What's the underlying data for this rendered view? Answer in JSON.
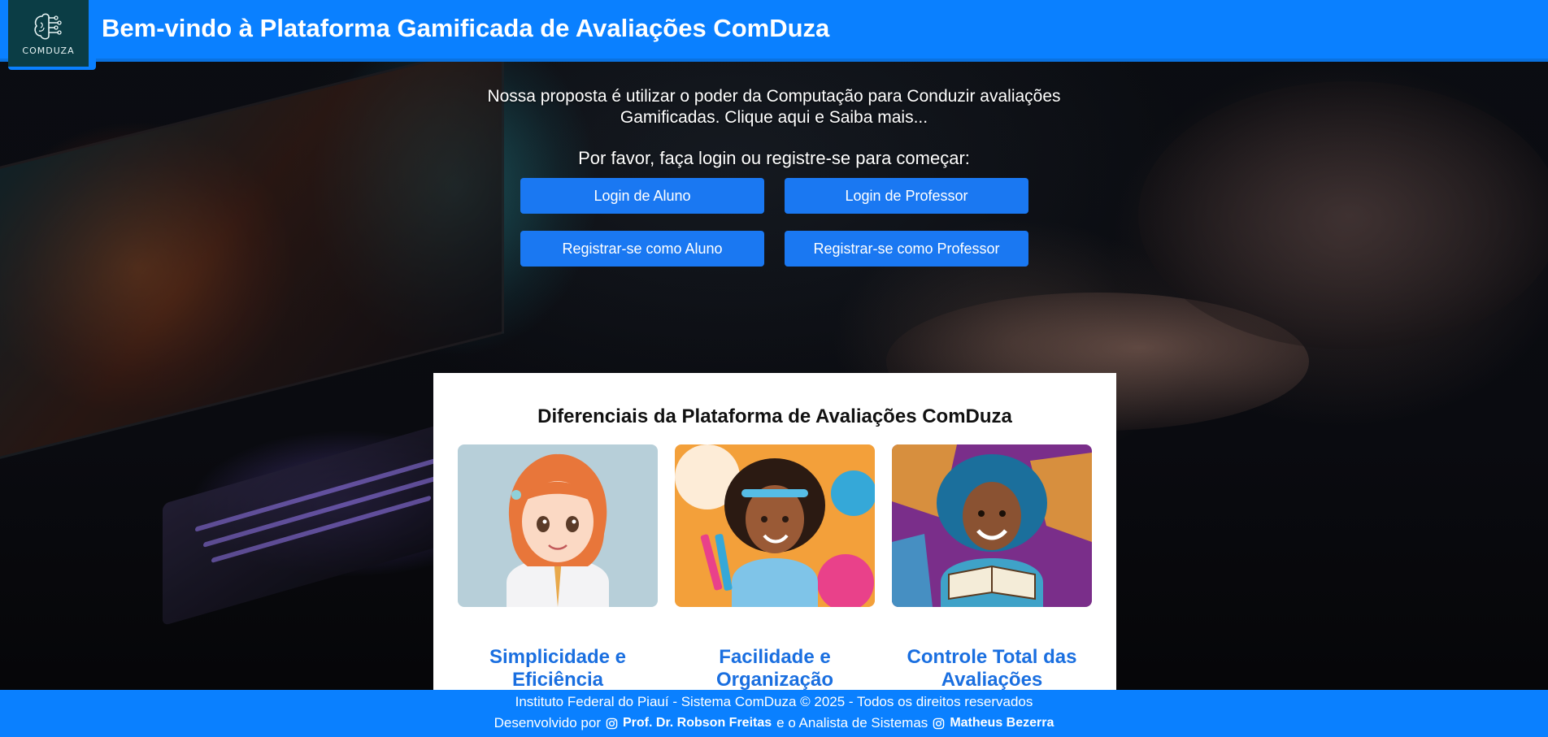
{
  "header": {
    "logo_text": "COMDUZA",
    "title": "Bem-vindo à Plataforma Gamificada de Avaliações ComDuza"
  },
  "intro": {
    "text": "Nossa proposta é utilizar o poder da Computação para Conduzir avaliações Gamificadas. Clique aqui e Saiba mais...",
    "prompt": "Por favor, faça login ou registre-se para começar:"
  },
  "buttons": {
    "login_aluno": "Login de Aluno",
    "login_professor": "Login de Professor",
    "registrar_aluno": "Registrar-se como Aluno",
    "registrar_professor": "Registrar-se como Professor"
  },
  "features": {
    "title": "Diferenciais da Plataforma de Avaliações ComDuza",
    "cards": [
      {
        "title": "Simplicidade e Eficiência"
      },
      {
        "title": "Facilidade e Organização"
      },
      {
        "title": "Controle Total das Avaliações"
      }
    ]
  },
  "footer": {
    "line1": "Instituto Federal do Piauí - Sistema ComDuza © 2025 - Todos os direitos reservados",
    "developed_by": "Desenvolvido por",
    "author1": "Prof. Dr. Robson Freitas",
    "connector": "e o Analista de Sistemas",
    "author2": "Matheus Bezerra"
  },
  "colors": {
    "primary": "#0a80ff",
    "button": "#1a78f2",
    "feature_title": "#1a6fe0",
    "logo_bg": "#0b3d45"
  }
}
